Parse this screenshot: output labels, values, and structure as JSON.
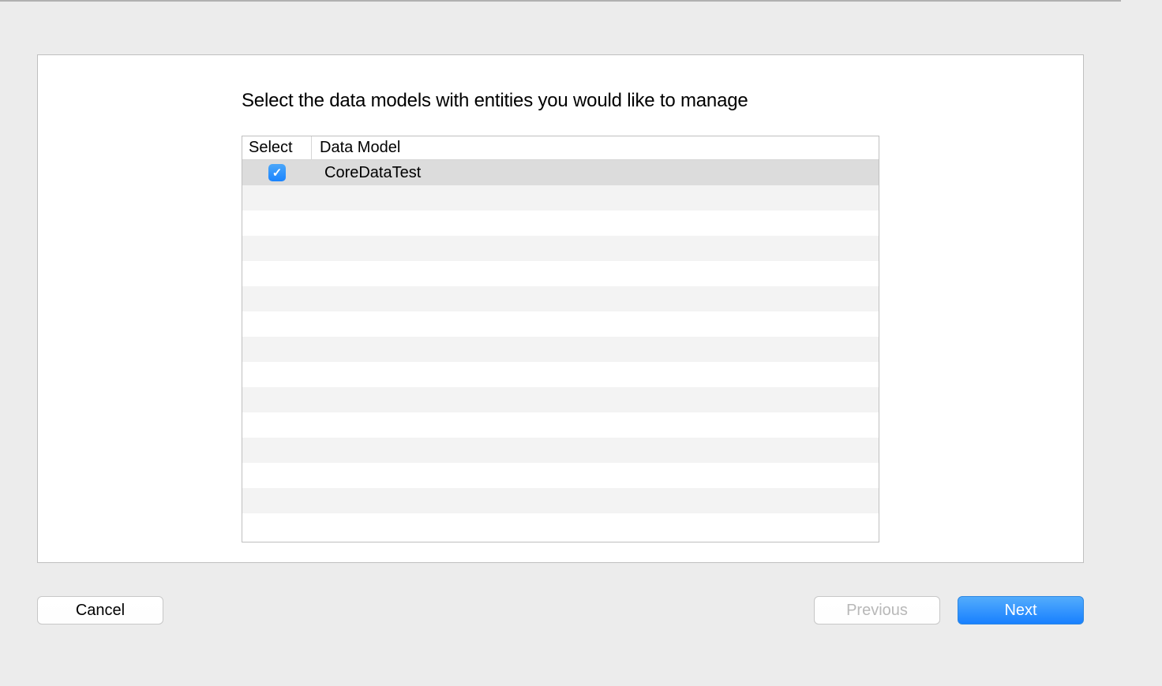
{
  "dialog": {
    "instruction": "Select the data models with entities you would like to manage",
    "table": {
      "headers": {
        "select": "Select",
        "model": "Data Model"
      },
      "rows": [
        {
          "checked": true,
          "model_name": "CoreDataTest",
          "selected": true
        }
      ]
    },
    "buttons": {
      "cancel": "Cancel",
      "previous": "Previous",
      "next": "Next"
    }
  },
  "colors": {
    "accent_blue": "#1a84ff",
    "disabled_text": "#b8b8b8",
    "selected_row": "#dcdcdc"
  }
}
